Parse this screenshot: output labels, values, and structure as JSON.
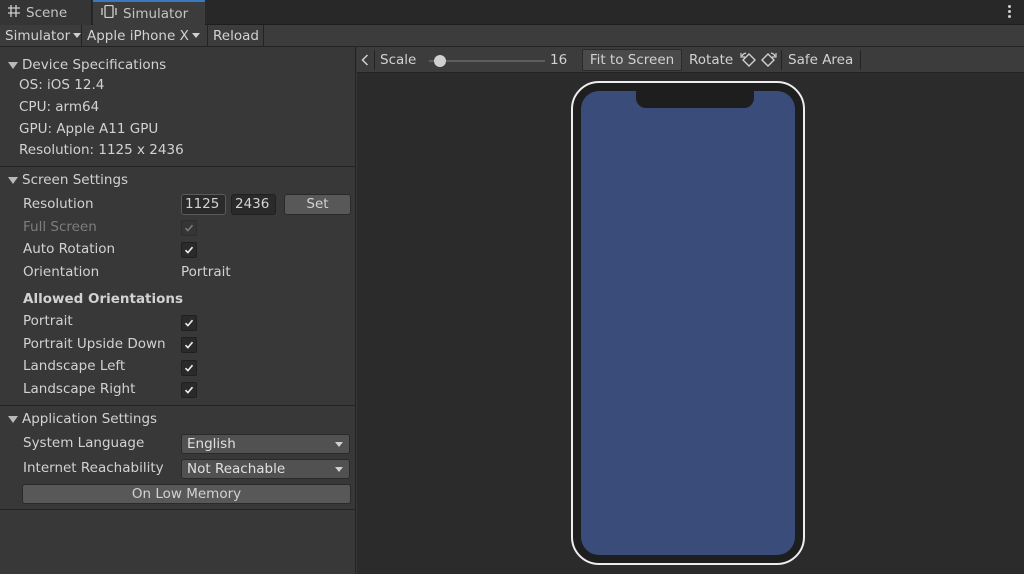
{
  "tabs": [
    {
      "label": "Scene",
      "icon": "grid-icon"
    },
    {
      "label": "Simulator",
      "icon": "phone-icon"
    }
  ],
  "toolbar": {
    "simulator_label": "Simulator",
    "device_label": "Apple iPhone X",
    "reload_label": "Reload"
  },
  "device_specs": {
    "header": "Device Specifications",
    "os": "OS: iOS 12.4",
    "cpu": "CPU: arm64",
    "gpu": "GPU: Apple A11 GPU",
    "resolution": "Resolution: 1125 x 2436"
  },
  "screen_settings": {
    "header": "Screen Settings",
    "resolution_label": "Resolution",
    "width_value": "1125",
    "height_value": "2436",
    "set_label": "Set",
    "full_screen_label": "Full Screen",
    "full_screen_checked": true,
    "auto_rotation_label": "Auto Rotation",
    "auto_rotation_checked": true,
    "orientation_label": "Orientation",
    "orientation_value": "Portrait",
    "allowed_header": "Allowed Orientations",
    "portrait_label": "Portrait",
    "upside_down_label": "Portrait Upside Down",
    "landscape_left_label": "Landscape Left",
    "landscape_right_label": "Landscape Right"
  },
  "app_settings": {
    "header": "Application Settings",
    "language_label": "System Language",
    "language_value": "English",
    "reachability_label": "Internet Reachability",
    "reachability_value": "Not Reachable",
    "low_memory_label": "On Low Memory"
  },
  "viewer": {
    "scale_label": "Scale",
    "scale_value": "16",
    "fit_label": "Fit to Screen",
    "rotate_label": "Rotate",
    "safe_area_label": "Safe Area",
    "screen_color": "#3a4c7a"
  }
}
